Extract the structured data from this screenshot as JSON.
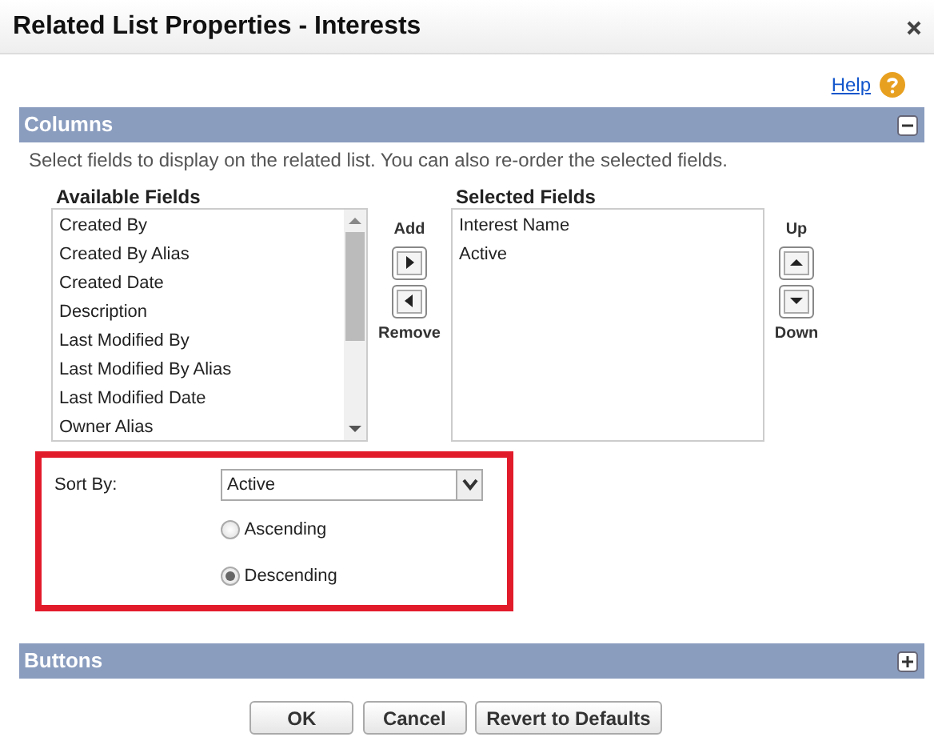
{
  "window": {
    "title": "Related List Properties - Interests"
  },
  "help": {
    "label": "Help"
  },
  "columns_section": {
    "title": "Columns",
    "expanded": true,
    "description": "Select fields to display on the related list. You can also re-order the selected fields.",
    "available": {
      "title": "Available Fields",
      "items": [
        "Created By",
        "Created By Alias",
        "Created Date",
        "Description",
        "Last Modified By",
        "Last Modified By Alias",
        "Last Modified Date",
        "Owner Alias"
      ]
    },
    "add_label": "Add",
    "remove_label": "Remove",
    "selected": {
      "title": "Selected Fields",
      "items": [
        "Interest Name",
        "Active"
      ]
    },
    "up_label": "Up",
    "down_label": "Down"
  },
  "sort": {
    "highlighted": true,
    "label": "Sort By:",
    "value": "Active",
    "options": [
      {
        "label": "Ascending",
        "selected": false
      },
      {
        "label": "Descending",
        "selected": true
      }
    ]
  },
  "buttons_section": {
    "title": "Buttons",
    "expanded": false
  },
  "actions": [
    "OK",
    "Cancel",
    "Revert to Defaults"
  ]
}
